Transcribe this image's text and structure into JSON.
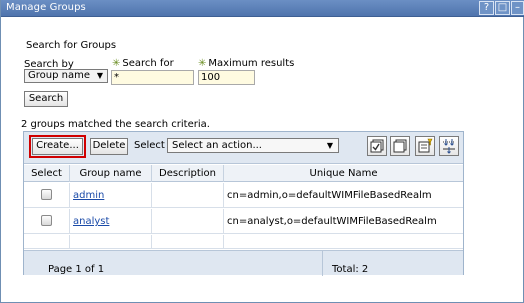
{
  "window": {
    "title": "Manage Groups",
    "help_label": "?",
    "max_label": "□",
    "min_label": "–"
  },
  "search": {
    "heading": "Search for Groups",
    "search_by_label": "Search by",
    "search_by_value": "Group name",
    "search_for_label": "Search for",
    "search_for_value": "*",
    "max_results_label": "Maximum results",
    "max_results_value": "100",
    "search_button": "Search",
    "required_marker": "✳"
  },
  "results": {
    "matched_text": "2 groups matched the search criteria.",
    "toolbar": {
      "create_label": "Create...",
      "delete_label": "Delete",
      "select_label": "Select",
      "action_select_value": "Select an action...",
      "icons": [
        "select-all-icon",
        "deselect-all-icon",
        "filter-icon",
        "collapse-icon"
      ]
    },
    "columns": [
      "Select",
      "Group name",
      "Description",
      "Unique Name"
    ],
    "rows": [
      {
        "name": "admin",
        "description": "",
        "unique_name": "cn=admin,o=defaultWIMFileBasedRealm"
      },
      {
        "name": "analyst",
        "description": "",
        "unique_name": "cn=analyst,o=defaultWIMFileBasedRealm"
      }
    ],
    "footer": {
      "page_text": "Page 1 of 1",
      "total_text": "Total: 2"
    }
  },
  "colors": {
    "titlebar": "#5b80b8",
    "highlight": "#d00000",
    "link": "#1a4aa8",
    "input_bg": "#fffbe1"
  }
}
